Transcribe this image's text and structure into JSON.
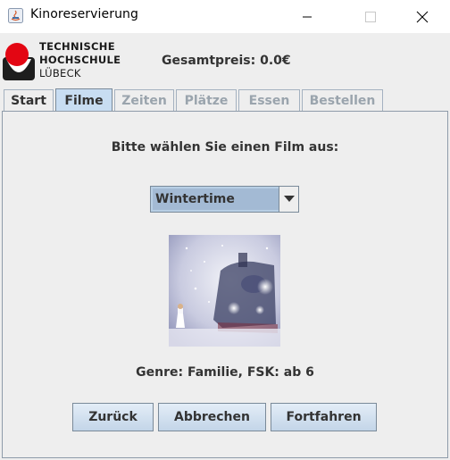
{
  "window": {
    "title": "Kinoreservierung",
    "controls": [
      "minimize-icon",
      "maximize-icon",
      "close-icon"
    ]
  },
  "header": {
    "logo": {
      "line1": "TECHNISCHE",
      "line2": "HOCHSCHULE",
      "line3": "LÜBECK"
    },
    "total_price": "Gesamtpreis: 0.0€"
  },
  "tabs": [
    {
      "label": "Start",
      "enabled": true
    },
    {
      "label": "Filme",
      "enabled": true,
      "selected": true
    },
    {
      "label": "Zeiten",
      "enabled": false
    },
    {
      "label": "Plätze",
      "enabled": false
    },
    {
      "label": "Essen",
      "enabled": false
    },
    {
      "label": "Bestellen",
      "enabled": false
    }
  ],
  "main": {
    "prompt": "Bitte wählen Sie einen Film aus:",
    "film_select": {
      "selected": "Wintertime"
    },
    "genre_info": "Genre: Familie, FSK: ab 6"
  },
  "buttons": {
    "back": "Zurück",
    "cancel": "Abbrechen",
    "next": "Fortfahren"
  },
  "colors": {
    "tab_active": "#c8ddf2",
    "accent_red": "#e30613"
  }
}
